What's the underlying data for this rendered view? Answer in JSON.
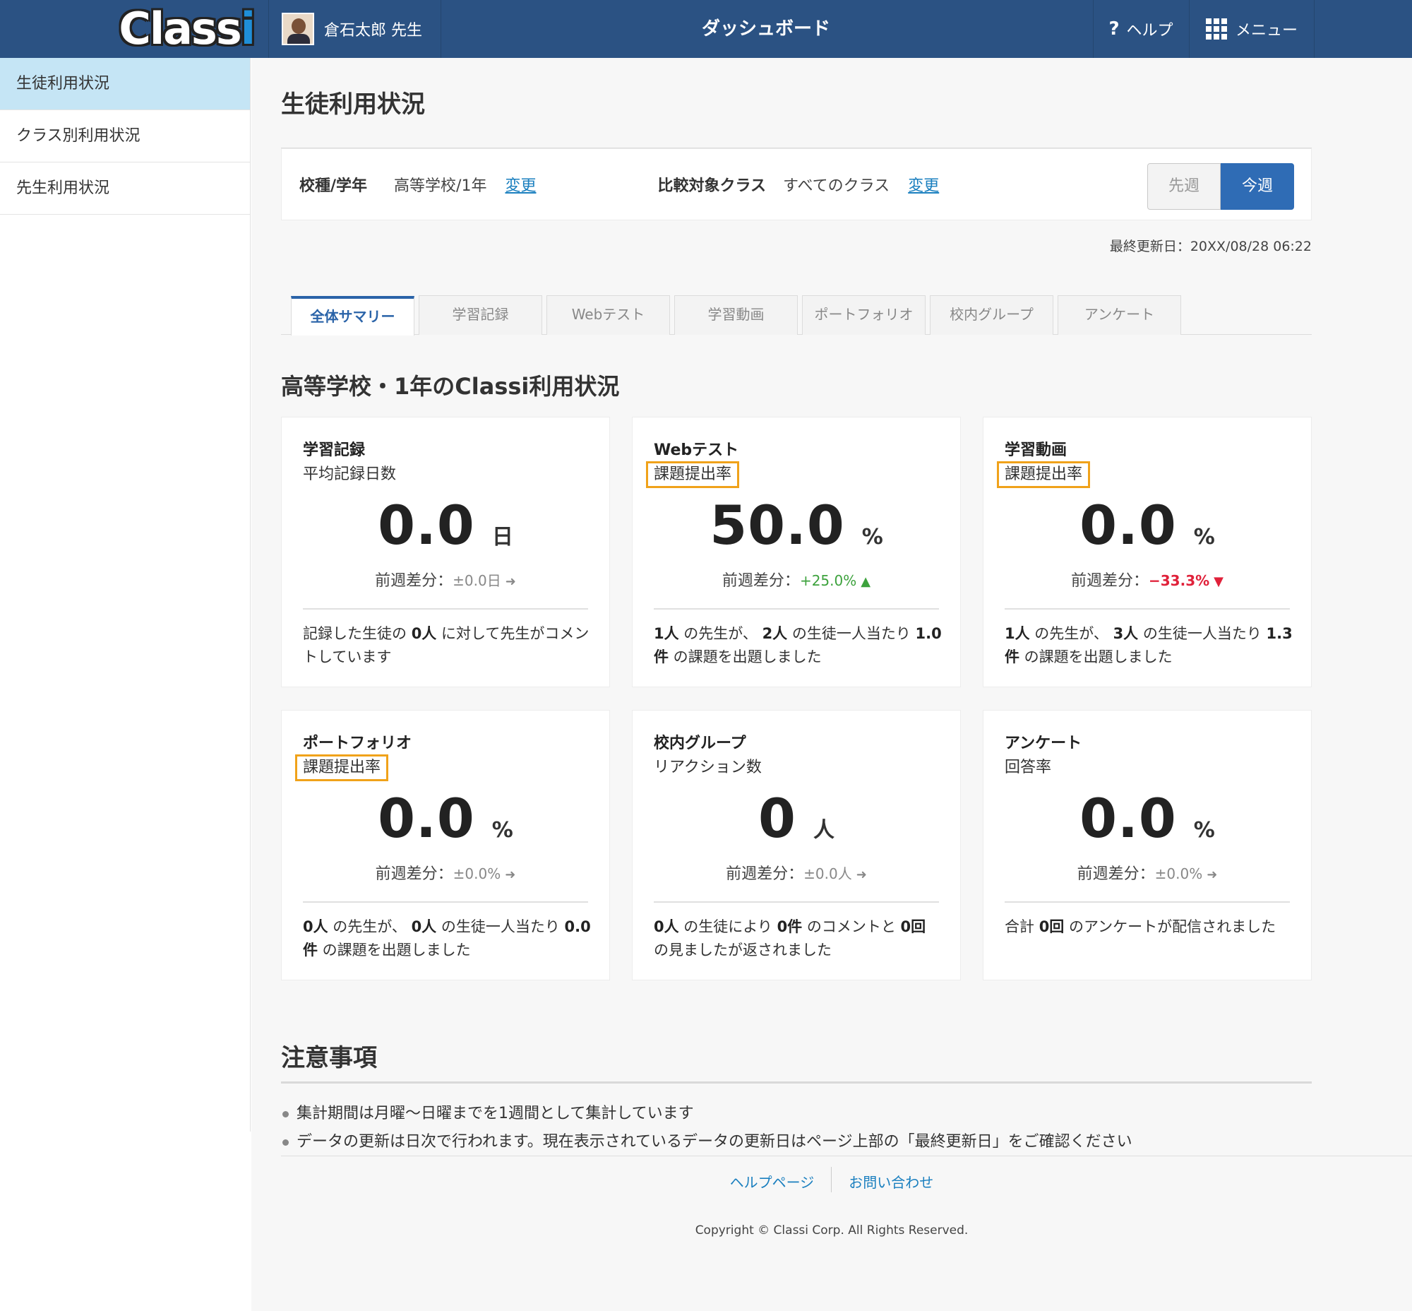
{
  "header": {
    "logo_text": "Class",
    "logo_i": "i",
    "user_name": "倉石太郎 先生",
    "title": "ダッシュボード",
    "help_icon": "?",
    "help_label": "ヘルプ",
    "menu_label": "メニュー"
  },
  "sidebar": {
    "items": [
      {
        "label": "生徒利用状況"
      },
      {
        "label": "クラス別利用状況"
      },
      {
        "label": "先生利用状況"
      }
    ]
  },
  "main": {
    "heading": "生徒利用状況",
    "filter": {
      "school_label": "校種/学年",
      "school_value": "高等学校/1年",
      "change1": "変更",
      "compare_label": "比較対象クラス",
      "compare_value": "すべてのクラス",
      "change2": "変更",
      "prev_week": "先週",
      "this_week": "今週"
    },
    "updated": "最終更新日：20XX/08/28 06:22",
    "tabs": [
      "全体サマリー",
      "学習記録",
      "Webテスト",
      "学習動画",
      "ポートフォリオ",
      "校内グループ",
      "アンケート"
    ],
    "summary_heading": "高等学校・1年のClassi利用状況",
    "cards": [
      {
        "title": "学習記録",
        "subtitle": "平均記録日数",
        "value": "0.0",
        "unit": "日",
        "diff_label": "前週差分：",
        "diff_value": "±0.0日",
        "arrow": "➜",
        "desc_parts": [
          "記録した生徒の ",
          "0人",
          " に対して先生がコメントしています"
        ]
      },
      {
        "title": "Webテスト",
        "subtitle": "課題提出率",
        "value": "50.0",
        "unit": "%",
        "diff_label": "前週差分：",
        "diff_value": "+25.0%",
        "arrow": "▲",
        "desc_parts": [
          "1人",
          " の先生が、 ",
          "2人",
          " の生徒一人当たり ",
          "1.0件",
          " の課題を出題しました"
        ]
      },
      {
        "title": "学習動画",
        "subtitle": "課題提出率",
        "value": "0.0",
        "unit": "%",
        "diff_label": "前週差分：",
        "diff_value": "−33.3%",
        "arrow": "▼",
        "desc_parts": [
          "1人",
          " の先生が、 ",
          "3人",
          " の生徒一人当たり ",
          "1.3件",
          " の課題を出題しました"
        ]
      },
      {
        "title": "ポートフォリオ",
        "subtitle": "課題提出率",
        "value": "0.0",
        "unit": "%",
        "diff_label": "前週差分：",
        "diff_value": "±0.0%",
        "arrow": "➜",
        "desc_parts": [
          "0人",
          " の先生が、 ",
          "0人",
          " の生徒一人当たり ",
          "0.0件",
          " の課題を出題しました"
        ]
      },
      {
        "title": "校内グループ",
        "subtitle": "リアクション数",
        "value": "0",
        "unit": "人",
        "diff_label": "前週差分：",
        "diff_value": "±0.0人",
        "arrow": "➜",
        "desc_parts": [
          "0人",
          " の生徒により ",
          "0件",
          " のコメントと ",
          "0回",
          " の見ましたが返されました"
        ]
      },
      {
        "title": "アンケート",
        "subtitle": "回答率",
        "value": "0.0",
        "unit": "%",
        "diff_label": "前週差分：",
        "diff_value": "±0.0%",
        "arrow": "➜",
        "desc_parts": [
          "合計 ",
          "0回",
          " のアンケートが配信されました"
        ]
      }
    ],
    "notes_heading": "注意事項",
    "notes": [
      "集計期間は月曜〜日曜までを1週間として集計しています",
      "データの更新は日次で行われます。現在表示されているデータの更新日はページ上部の「最終更新日」をご確認ください"
    ]
  },
  "footer": {
    "help_link": "ヘルプページ",
    "contact_link": "お問い合わせ",
    "copyright": "Copyright © Classi Corp. All Rights Reserved."
  },
  "colors": {
    "header_bg": "#2b5283",
    "sidebar_active": "#c5e5f5",
    "accent": "#2f6cb5",
    "highlight": "#f0a21a",
    "up": "#3da23d",
    "down": "#e0213a"
  }
}
